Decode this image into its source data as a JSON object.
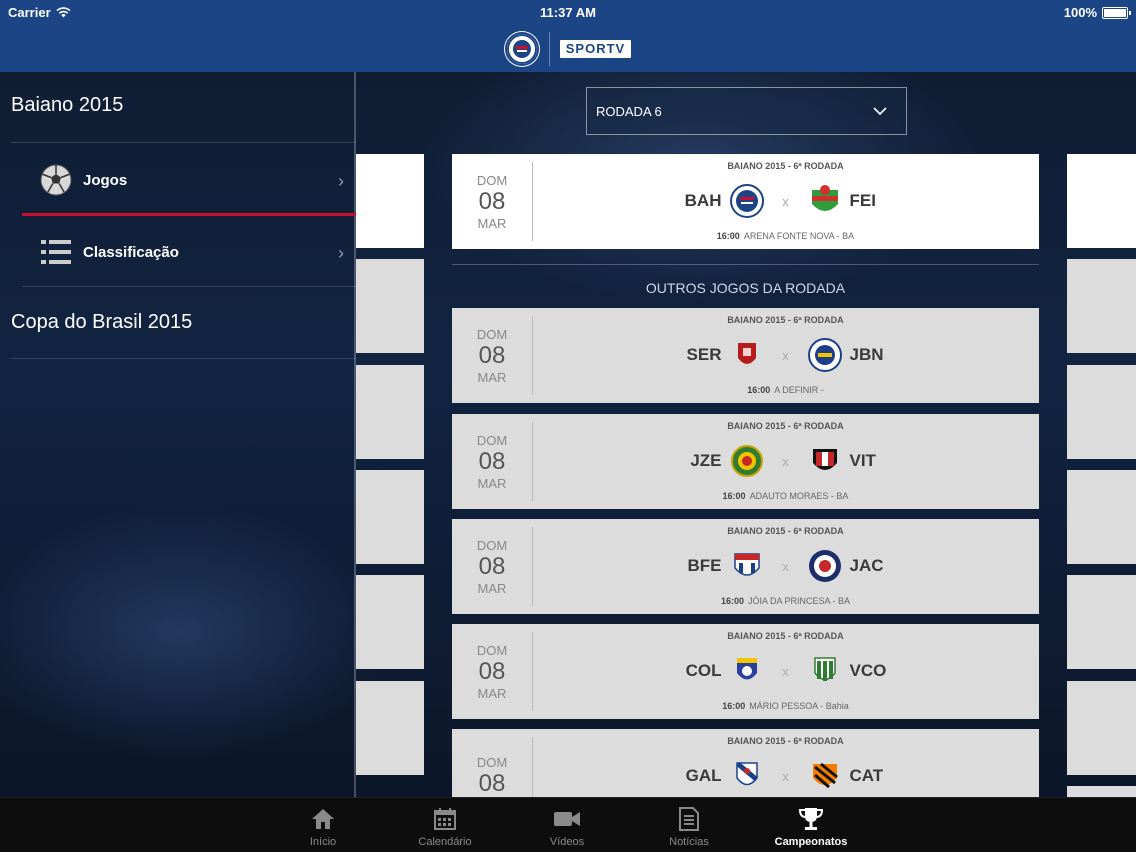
{
  "status_bar": {
    "carrier": "Carrier",
    "time": "11:37 AM",
    "battery": "100%"
  },
  "nav": {
    "logo_text": "SPORTV"
  },
  "sidebar": {
    "sections": [
      {
        "title": "Baiano 2015"
      },
      {
        "title": "Copa do Brasil 2015"
      }
    ],
    "items": [
      {
        "label": "Jogos",
        "icon": "soccer-ball-icon",
        "active": true
      },
      {
        "label": "Classificação",
        "icon": "list-icon",
        "active": false
      }
    ]
  },
  "round_select": {
    "value": "RODADA 6"
  },
  "featured_match": {
    "dow": "DOM",
    "day": "08",
    "month": "MAR",
    "round": "BAIANO 2015 - 6ª RODADA",
    "home": "BAH",
    "away": "FEI",
    "vs": "x",
    "time": "16:00",
    "venue": "ARENA FONTE NOVA - BA"
  },
  "others_title": "OUTROS JOGOS DA RODADA",
  "other_matches": [
    {
      "dow": "DOM",
      "day": "08",
      "month": "MAR",
      "round": "BAIANO 2015 - 6ª RODADA",
      "home": "SER",
      "away": "JBN",
      "vs": "x",
      "time": "16:00",
      "venue": "A DEFINIR -"
    },
    {
      "dow": "DOM",
      "day": "08",
      "month": "MAR",
      "round": "BAIANO 2015 - 6ª RODADA",
      "home": "JZE",
      "away": "VIT",
      "vs": "x",
      "time": "16:00",
      "venue": "ADAUTO MORAES - BA"
    },
    {
      "dow": "DOM",
      "day": "08",
      "month": "MAR",
      "round": "BAIANO 2015 - 6ª RODADA",
      "home": "BFE",
      "away": "JAC",
      "vs": "x",
      "time": "16:00",
      "venue": "JÓIA DA PRINCESA - BA"
    },
    {
      "dow": "DOM",
      "day": "08",
      "month": "MAR",
      "round": "BAIANO 2015 - 6ª RODADA",
      "home": "COL",
      "away": "VCO",
      "vs": "x",
      "time": "16:00",
      "venue": "MÁRIO PESSOA - Bahia"
    },
    {
      "dow": "DOM",
      "day": "08",
      "month": "",
      "round": "BAIANO 2015 - 6ª RODADA",
      "home": "GAL",
      "away": "CAT",
      "vs": "x",
      "time": "",
      "venue": ""
    }
  ],
  "tabs": [
    {
      "label": "Início",
      "icon": "home-icon",
      "active": false
    },
    {
      "label": "Calendário",
      "icon": "calendar-icon",
      "active": false
    },
    {
      "label": "Vídeos",
      "icon": "video-camera-icon",
      "active": false
    },
    {
      "label": "Notícias",
      "icon": "news-icon",
      "active": false
    },
    {
      "label": "Campeonatos",
      "icon": "trophy-icon",
      "active": true
    }
  ],
  "colors": {
    "header_blue": "#1c4585",
    "accent_red": "#c8102e",
    "card_grey": "#dcdcdc"
  }
}
